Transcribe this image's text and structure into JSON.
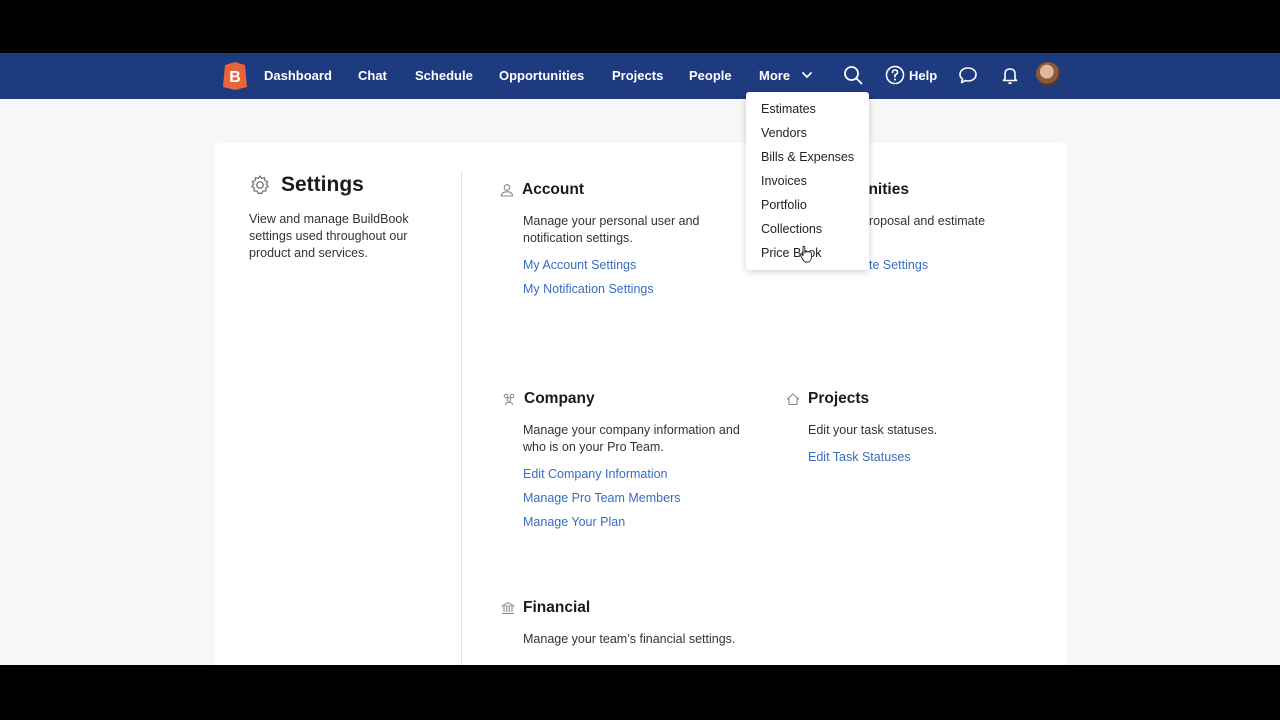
{
  "nav": {
    "items": [
      "Dashboard",
      "Chat",
      "Schedule",
      "Opportunities",
      "Projects",
      "People"
    ],
    "more_label": "More",
    "help_label": "Help"
  },
  "settings": {
    "title": "Settings",
    "description": "View and manage BuildBook settings used throughout our product and services."
  },
  "sections": {
    "account": {
      "title": "Account",
      "description": "Manage your personal user and notification settings.",
      "links": [
        "My Account Settings",
        "My Notification Settings"
      ]
    },
    "opportunities": {
      "title_partial": "unities",
      "description_partial": "roposal and estimate",
      "link_partial": "te Settings"
    },
    "company": {
      "title": "Company",
      "description": "Manage your company information and who is on your Pro Team.",
      "links": [
        "Edit Company Information",
        "Manage Pro Team Members",
        "Manage Your Plan"
      ]
    },
    "projects": {
      "title": "Projects",
      "description": "Edit your task statuses.",
      "links": [
        "Edit Task Statuses"
      ]
    },
    "financial": {
      "title": "Financial",
      "description": "Manage your team’s financial settings."
    }
  },
  "more_menu": [
    "Estimates",
    "Vendors",
    "Bills & Expenses",
    "Invoices",
    "Portfolio",
    "Collections",
    "Price Book"
  ],
  "colors": {
    "navbar": "#1d3b7e",
    "link": "#3b6cc0",
    "logo": "#e8643a"
  }
}
